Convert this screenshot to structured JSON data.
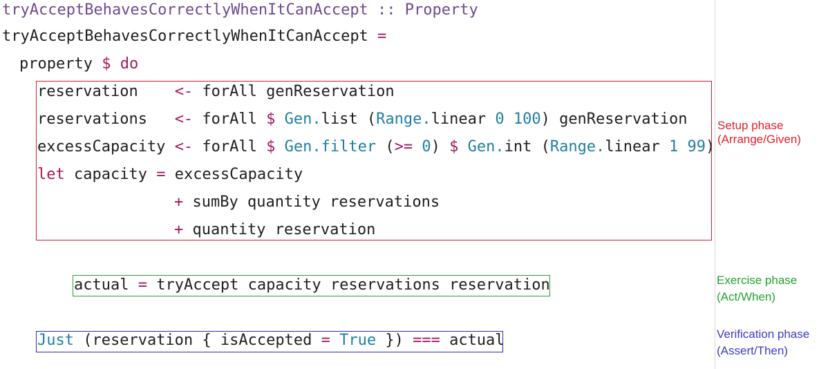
{
  "code": {
    "line1": {
      "name": "tryAcceptBehavesCorrectlyWhenItCanAccept",
      "sep": " :: ",
      "type": "Property"
    },
    "line2": {
      "name": "tryAcceptBehavesCorrectlyWhenItCanAccept",
      "eq": " ="
    },
    "line3": {
      "fn": "property",
      "dollar": "$",
      "do": "do"
    },
    "line4": {
      "var": "reservation    ",
      "arrow": "<-",
      "rest": " forAll genReservation"
    },
    "line5": {
      "var": "reservations   ",
      "arrow": "<-",
      "a": " forAll ",
      "dollar": "$",
      "b": " ",
      "mod": "Gen.",
      "c": "list (",
      "mod2": "Range.",
      "d": "linear ",
      "n1": "0",
      "e": " ",
      "n2": "100",
      "f": ") genReservation"
    },
    "line6": {
      "var": "excessCapacity ",
      "arrow": "<-",
      "a": " forAll ",
      "dollar": "$",
      "b": " ",
      "mod": "Gen.filter",
      "c": " (",
      "op": ">=",
      "d": " ",
      "n0": "0",
      "e": ") ",
      "dollar2": "$",
      "f": " ",
      "mod2": "Gen.",
      "g": "int (",
      "mod3": "Range.",
      "h": "linear ",
      "n1": "1",
      "i": " ",
      "n2": "99",
      "j": ")"
    },
    "line7": {
      "kw": "let",
      "a": " capacity ",
      "eq": "=",
      "b": " excessCapacity"
    },
    "line8": {
      "plus": "+",
      "rest": " sumBy quantity reservations"
    },
    "line9": {
      "plus": "+",
      "rest": " quantity reservation"
    },
    "line10": {
      "a": "actual ",
      "eq": "=",
      "b": " tryAccept capacity reservations reservation"
    },
    "line11": {
      "con": "Just",
      "a": " (reservation { isAccepted ",
      "eq": "=",
      "b": " ",
      "con2": "True",
      "c": " }) ",
      "op": "===",
      "d": " actual"
    }
  },
  "annotations": {
    "setup": {
      "title": "Setup phase",
      "subtitle": "(Arrange/Given)",
      "color": "#e0202a"
    },
    "exercise": {
      "title": "Exercise phase",
      "subtitle": "(Act/When)",
      "color": "#22a232"
    },
    "verify": {
      "title": "Verification phase",
      "subtitle": "(Assert/Then)",
      "color": "#3b3bc7"
    }
  }
}
